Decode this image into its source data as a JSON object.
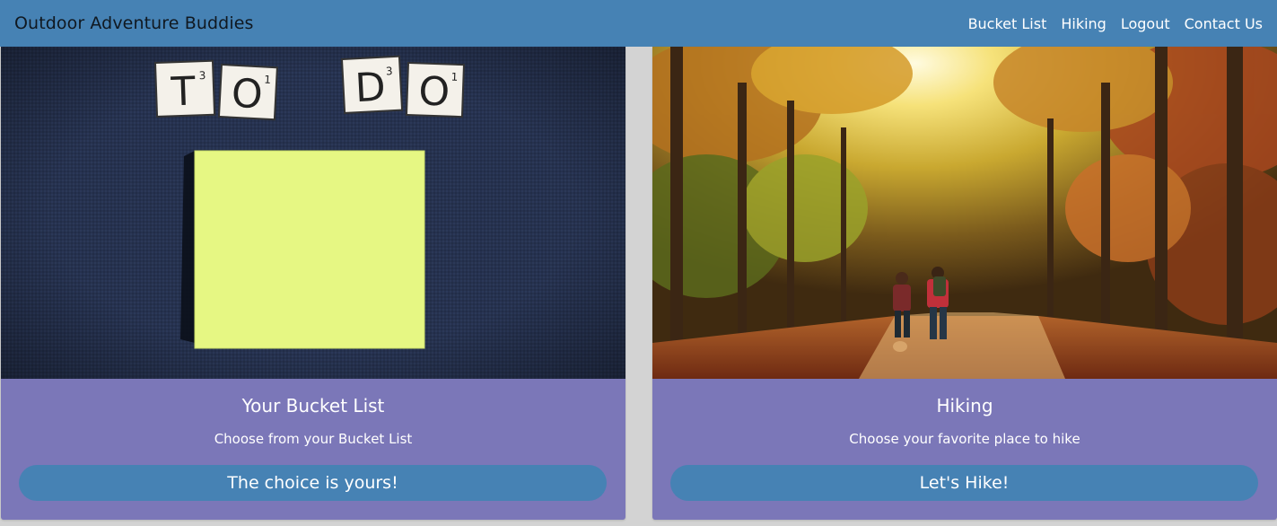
{
  "navbar": {
    "brand": "Outdoor Adventure Buddies",
    "links": [
      {
        "label": "Bucket List"
      },
      {
        "label": "Hiking"
      },
      {
        "label": "Logout"
      },
      {
        "label": "Contact Us"
      }
    ]
  },
  "cards": [
    {
      "title": "Your Bucket List",
      "text": "Choose from your Bucket List",
      "button_label": "The choice is yours!"
    },
    {
      "title": "Hiking",
      "text": "Choose your favorite place to hike",
      "button_label": "Let's Hike!"
    }
  ],
  "tiles": {
    "word1": [
      {
        "letter": "T",
        "score": "3"
      },
      {
        "letter": "O",
        "score": "1"
      }
    ],
    "word2": [
      {
        "letter": "D",
        "score": "3"
      },
      {
        "letter": "O",
        "score": "1"
      }
    ]
  },
  "colors": {
    "navbar": "#4682b4",
    "card": "#7b77b8",
    "button": "#4682b4",
    "page_background": "#d3d3d3"
  }
}
